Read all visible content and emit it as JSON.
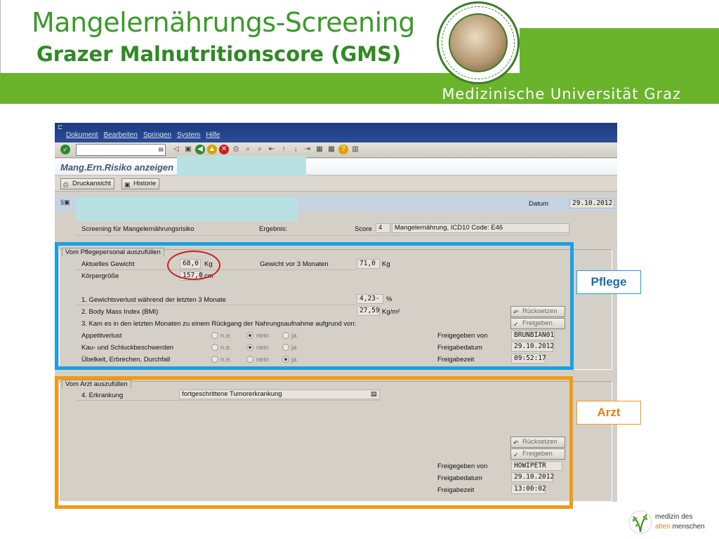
{
  "header": {
    "title": "Mangelernährungs-Screening",
    "subtitle": "Grazer Malnutritionscore (GMS)",
    "university": "Medizinische Universität Graz",
    "seal_text": "SALUS ÆGROTI SUPREMA LEX · MEDIZINISCHE UNIVERSITÄT GRAZ"
  },
  "colors": {
    "brand_green": "#6ab42c",
    "title_green": "#3a9a2a",
    "frame_pflege": "#1aa0e2",
    "frame_arzt": "#f09a14",
    "highlight_red": "#c82020"
  },
  "sap": {
    "menu": [
      "Dokument",
      "Bearbeiten",
      "Springen",
      "System",
      "Hilfe"
    ],
    "toolbar_icons": [
      "enter-icon",
      "save-icon",
      "back-icon",
      "exit-icon",
      "cancel-icon",
      "print-icon",
      "find-icon",
      "find-next-icon",
      "first-page-icon",
      "prev-page-icon",
      "next-page-icon",
      "last-page-icon",
      "new-session-icon",
      "shortcut-icon",
      "help-icon",
      "layout-icon"
    ],
    "window_title": "Mang.Ern.Risiko anzeigen",
    "app_buttons": {
      "print": "Druckansicht",
      "history": "Historie"
    },
    "datum_label": "Datum",
    "datum_value": "29.10.2012",
    "screening": {
      "label": "Screening für Mangelernährungsrisiko",
      "result_label": "Ergebnis:",
      "score_label": "Score",
      "score_value": "4",
      "result_text": "Mangelernährung, ICD10 Code: E46"
    },
    "pflege": {
      "group_title": "Vom Pflegepersonal auszufüllen",
      "current_weight_label": "Aktuelles Gewicht",
      "current_weight_value": "68,0",
      "current_weight_unit": "Kg",
      "height_label": "Körpergröße",
      "height_value": "157,0",
      "height_unit": "cm",
      "weight_3m_label": "Gewicht vor 3 Monaten",
      "weight_3m_value": "71,0",
      "weight_3m_unit": "Kg",
      "loss_label": "1. Gewichtsverlust während der letzten 3 Monate",
      "loss_value": "4,23-",
      "loss_unit": "%",
      "bmi_label": "2. Body Mass Index (BMI)",
      "bmi_value": "27,59",
      "bmi_unit": "Kg/m²",
      "q3_label": "3. Kam es in den letzten Monaten zu einem Rückgang der Nahrungsaufnahme aufgrund von:",
      "options": [
        "n.e.",
        "nein",
        "ja"
      ],
      "rows": [
        {
          "label": "Appetitverlust",
          "selected": 1
        },
        {
          "label": "Kau- und Schluckbeschwerden",
          "selected": 1
        },
        {
          "label": "Übelkeit, Erbrechen, Durchfall",
          "selected": 2
        }
      ],
      "reset_label": "Rücksetzen",
      "release_label": "Freigeben",
      "released_by_label": "Freigegeben von",
      "released_by_value": "BRUNBIAN01",
      "release_date_label": "Freigabedatum",
      "release_date_value": "29.10.2012",
      "release_time_label": "Freigabezeit",
      "release_time_value": "09:52:17"
    },
    "arzt": {
      "group_title": "Vom Arzt auszufüllen",
      "disease_label": "4. Erkrankung",
      "disease_value": "fortgeschrittene Tumorerkrankung",
      "reset_label": "Rücksetzen",
      "release_label": "Freigeben",
      "released_by_label": "Freigegeben von",
      "released_by_value": "HOWIPETR",
      "release_date_label": "Freigabedatum",
      "release_date_value": "29.10.2012",
      "release_time_label": "Freigabezeit",
      "release_time_value": "13:00:02"
    }
  },
  "annotations": {
    "pflege_tag": "Pflege",
    "arzt_tag": "Arzt"
  },
  "footer": {
    "logo_line1": "medizin des",
    "logo_line2a": "alten",
    "logo_line2b": " menschen"
  }
}
